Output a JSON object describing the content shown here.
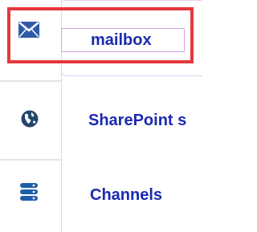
{
  "menu": {
    "items": [
      {
        "label": "mailbox",
        "icon": "mail-icon",
        "selected": true
      },
      {
        "label": "SharePoint s",
        "icon": "globe-icon",
        "selected": false
      },
      {
        "label": "Channels",
        "icon": "channels-icon",
        "selected": false
      }
    ]
  },
  "colors": {
    "label": "#1b2ab0",
    "icon": "#2a4a6a",
    "highlight": "#e5383d",
    "selection_border": "#d59ce6",
    "panel_border": "#e6d1f0"
  }
}
